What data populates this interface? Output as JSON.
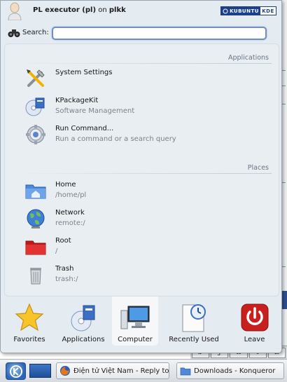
{
  "header": {
    "user_name": "PL executor (pl)",
    "host_prefix": "on",
    "host": "plkk",
    "logo_left": "KUBUNTU",
    "logo_right": "KDE"
  },
  "search": {
    "label": "Search:",
    "value": "",
    "placeholder": ""
  },
  "applications": {
    "heading": "Applications",
    "items": [
      {
        "title": "System Settings",
        "subtitle": "",
        "icon": "settings-tools-icon"
      },
      {
        "title": "KPackageKit",
        "subtitle": "Software Management",
        "icon": "package-icon"
      },
      {
        "title": "Run Command...",
        "subtitle": "Run a command or a search query",
        "icon": "gear-icon"
      }
    ]
  },
  "places": {
    "heading": "Places",
    "items": [
      {
        "title": "Home",
        "subtitle": "/home/pl",
        "icon": "home-folder-icon"
      },
      {
        "title": "Network",
        "subtitle": "remote:/",
        "icon": "globe-icon"
      },
      {
        "title": "Root",
        "subtitle": "/",
        "icon": "red-folder-icon"
      },
      {
        "title": "Trash",
        "subtitle": "trash:/",
        "icon": "trash-icon"
      }
    ]
  },
  "tabs": [
    {
      "label": "Favorites",
      "icon": "star-icon",
      "active": false
    },
    {
      "label": "Applications",
      "icon": "cd-package-icon",
      "active": false
    },
    {
      "label": "Computer",
      "icon": "computer-icon",
      "active": true
    },
    {
      "label": "Recently Used",
      "icon": "clock-document-icon",
      "active": false
    },
    {
      "label": "Leave",
      "icon": "power-icon",
      "active": false
    }
  ],
  "taskbar": {
    "tasks": [
      {
        "label": "Điện tử Việt Nam - Reply to",
        "icon": "firefox-icon"
      },
      {
        "label": "Downloads - Konqueror",
        "icon": "folder-icon"
      }
    ]
  },
  "background": {
    "keys": [
      "a'",
      "J",
      "II",
      "I",
      "Z"
    ]
  },
  "colors": {
    "menu_bg": "#e4ebf1",
    "search_border": "#6f8fc0",
    "logo_blue": "#1d3f8f",
    "leave_red": "#c8201e"
  }
}
